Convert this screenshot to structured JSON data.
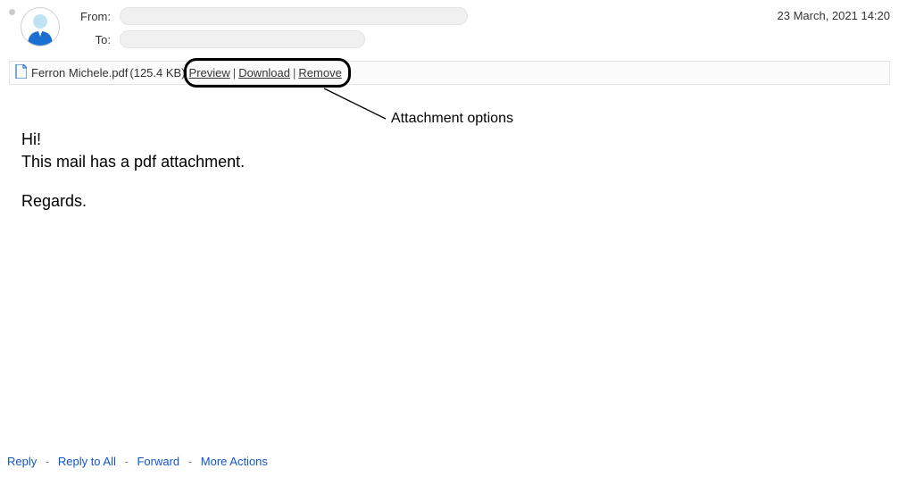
{
  "header": {
    "from_label": "From:",
    "to_label": "To:",
    "timestamp": "23 March, 2021 14:20"
  },
  "attachment": {
    "filename": "Ferron Michele.pdf",
    "size": "(125.4 KB)",
    "preview": "Preview",
    "download": "Download",
    "remove": "Remove"
  },
  "annotation": {
    "label": "Attachment options"
  },
  "body": {
    "line1": "Hi!",
    "line2": "This mail has a pdf attachment.",
    "line3": "Regards."
  },
  "footer": {
    "reply": "Reply",
    "reply_all": "Reply to All",
    "forward": "Forward",
    "more": "More Actions"
  }
}
